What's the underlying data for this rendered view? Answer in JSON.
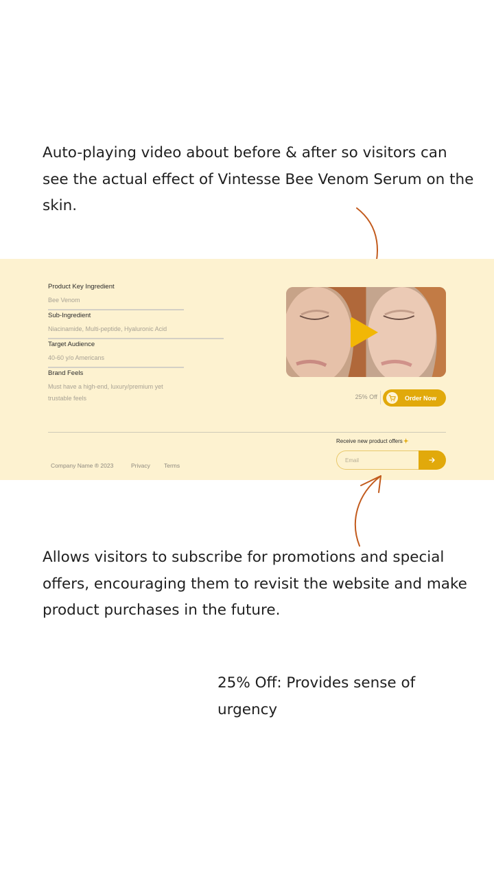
{
  "annotations": {
    "video": "Auto-playing video about before & after so visitors can see the actual effect of Vintesse Bee Venom Serum on the skin.",
    "subscribe": "Allows visitors to subscribe for promotions and special offers, encouraging them to revisit the website and make product purchases in the future.",
    "discount": "25% Off: Provides sense of urgency"
  },
  "product": {
    "fields": [
      {
        "label": "Product Key Ingredient",
        "value": "Bee Venom"
      },
      {
        "label": "Sub-Ingredient",
        "value": "Niacinamide, Multi-peptide, Hyaluronic Acid"
      },
      {
        "label": "Target Audience",
        "value": "40-60 y/o Americans"
      },
      {
        "label": "Brand Feels",
        "value": "Must have a high-end, luxury/premium yet trustable feels"
      }
    ]
  },
  "offer": {
    "discount": "25% Off",
    "order_label": "Order Now"
  },
  "footer": {
    "company": "Company Name ® 2023",
    "privacy": "Privacy",
    "terms": "Terms",
    "receive_offers": "Receive new product offers",
    "email_placeholder": "Email"
  },
  "colors": {
    "accent": "#e1a90b",
    "panel_bg": "#fdf2d0",
    "play": "#f2b705",
    "annotation_arrow": "#c25a1c"
  },
  "icons": {
    "play": "play-icon",
    "cart": "cart-icon",
    "submit": "arrow-right-icon",
    "sparkle": "sparkle-icon"
  }
}
